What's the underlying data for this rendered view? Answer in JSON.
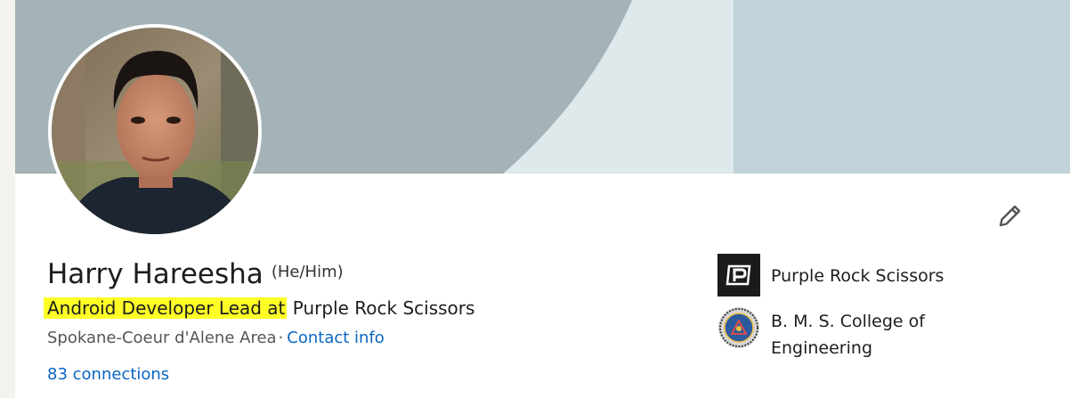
{
  "profile": {
    "name": "Harry Hareesha",
    "pronouns": "(He/Him)",
    "headline_highlight": "Android Developer Lead at",
    "headline_rest": " Purple Rock Scissors",
    "location": "Spokane-Coeur d'Alene Area",
    "separator": "·",
    "contact_label": "Contact info",
    "connections_label": "83 connections"
  },
  "organizations": [
    {
      "name": "Purple Rock Scissors",
      "logo": "purple-rock-scissors-logo"
    },
    {
      "name": "B. M. S. College of Engineering",
      "logo": "bms-college-seal"
    }
  ],
  "icons": {
    "edit": "pencil-icon"
  },
  "colors": {
    "link": "#0a66c2",
    "highlight": "#ffff27",
    "cover_dark": "#a3b3b7",
    "cover_light": "#c0d3d8"
  }
}
